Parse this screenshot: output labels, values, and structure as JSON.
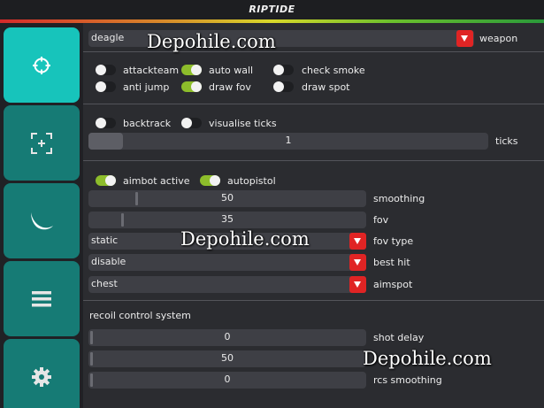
{
  "app": {
    "title": "RIPTIDE"
  },
  "sidebar": {
    "items": [
      {
        "icon": "crosshair-icon",
        "active": true
      },
      {
        "icon": "target-bracket-icon",
        "active": false
      },
      {
        "icon": "knife-icon",
        "active": false
      },
      {
        "icon": "menu-lines-icon",
        "active": false
      },
      {
        "icon": "gear-icon",
        "active": false
      }
    ]
  },
  "weapon": {
    "value": "deagle",
    "label": "weapon"
  },
  "toggles": {
    "attackteam": {
      "label": "attackteam",
      "on": false
    },
    "auto_wall": {
      "label": "auto wall",
      "on": true
    },
    "check_smoke": {
      "label": "check smoke",
      "on": false
    },
    "anti_jump": {
      "label": "anti jump",
      "on": false
    },
    "draw_fov": {
      "label": "draw fov",
      "on": true
    },
    "draw_spot": {
      "label": "draw spot",
      "on": false
    },
    "backtrack": {
      "label": "backtrack",
      "on": false
    },
    "visualise_ticks": {
      "label": "visualise ticks",
      "on": false
    },
    "aimbot_active": {
      "label": "aimbot active",
      "on": true
    },
    "autopistol": {
      "label": "autopistol",
      "on": true
    }
  },
  "ticks": {
    "value": "1",
    "label": "ticks",
    "fraction": 0.05
  },
  "smoothing": {
    "value": "50",
    "label": "smoothing",
    "fraction": 0.17
  },
  "fov": {
    "value": "35",
    "label": "fov",
    "fraction": 0.12
  },
  "fov_type": {
    "value": "static",
    "label": "fov type"
  },
  "best_hit": {
    "value": "disable",
    "label": "best hit"
  },
  "aimspot": {
    "value": "chest",
    "label": "aimspot"
  },
  "recoil": {
    "heading": "recoil control system",
    "shot_delay": {
      "value": "0",
      "label": "shot delay",
      "fraction": 0.0
    },
    "rcs_mid": {
      "value": "50",
      "fraction": 0.0
    },
    "rcs_smoothing": {
      "value": "0",
      "label": "rcs smoothing",
      "fraction": 0.0
    }
  },
  "watermark": {
    "text": "Depohile.com"
  },
  "colors": {
    "accent": "#17c4bb",
    "toggle_on": "#8dbd2b",
    "dropdown": "#e02424"
  }
}
